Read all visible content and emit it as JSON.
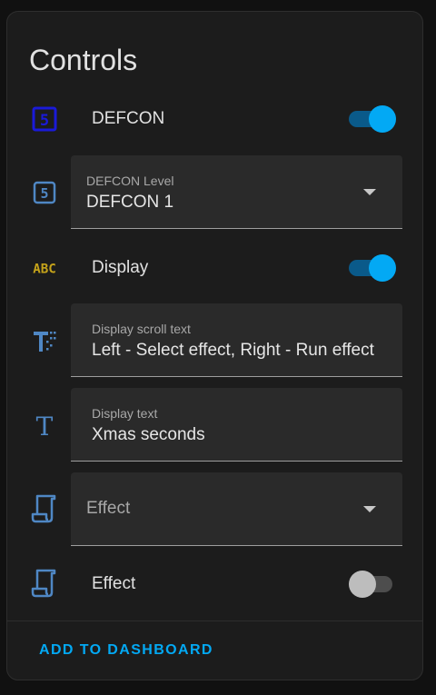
{
  "card": {
    "title": "Controls",
    "action_label": "ADD TO DASHBOARD"
  },
  "rows": {
    "defcon_switch": {
      "label": "DEFCON",
      "state": "on",
      "icon": "defcon-5-icon",
      "icon_text": "5"
    },
    "defcon_level": {
      "label": "DEFCON Level",
      "value": "DEFCON 1",
      "icon": "numeric-5-box-icon",
      "icon_text": "5"
    },
    "display_switch": {
      "label": "Display",
      "state": "on",
      "icon": "alphabetical-icon",
      "icon_text": "ABC"
    },
    "display_scroll_text": {
      "label": "Display scroll text",
      "value": "Left - Select effect, Right - Run effect",
      "icon": "format-text-scroll-icon"
    },
    "display_text": {
      "label": "Display text",
      "value": "Xmas seconds",
      "icon": "format-text-icon",
      "icon_text": "T"
    },
    "effect_select": {
      "placeholder": "Effect",
      "icon": "script-icon"
    },
    "effect_switch": {
      "label": "Effect",
      "state": "off",
      "icon": "script-icon"
    }
  },
  "colors": {
    "accent": "#03a9f4",
    "icon_blue": "#4f87c4",
    "defcon_icon": "#1a1ad8",
    "abc_icon": "#c4a21a"
  }
}
